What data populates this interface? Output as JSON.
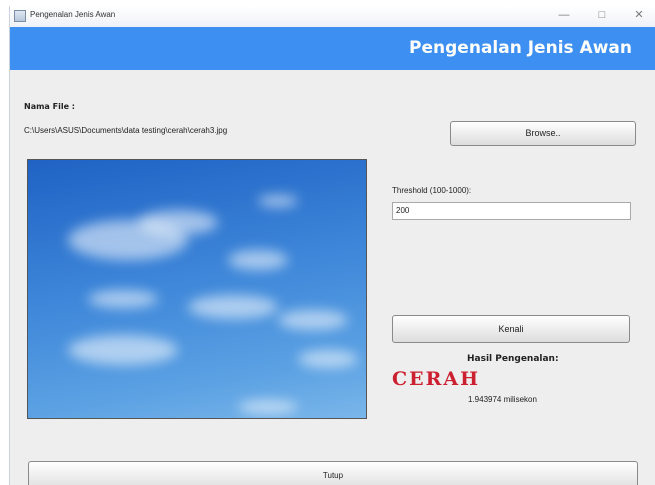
{
  "window": {
    "title": "Pengenalan Jenis Awan",
    "minimize": "—",
    "maximize": "□",
    "close": "✕"
  },
  "header": {
    "title": "Pengenalan Jenis Awan"
  },
  "file": {
    "label": "Nama File :",
    "path": "C:\\Users\\ASUS\\Documents\\data testing\\cerah\\cerah3.jpg",
    "browse_label": "Browse.."
  },
  "threshold": {
    "label": "Threshold (100-1000):",
    "value": "200"
  },
  "actions": {
    "recognize_label": "Kenali",
    "close_label": "Tutup"
  },
  "result": {
    "heading": "Hasil Pengenalan:",
    "value": "CERAH",
    "time": "1.943974 milisekon"
  },
  "colors": {
    "banner": "#3d8ff2",
    "result": "#cc1f2f"
  },
  "image": {
    "icon": "sky-image"
  }
}
